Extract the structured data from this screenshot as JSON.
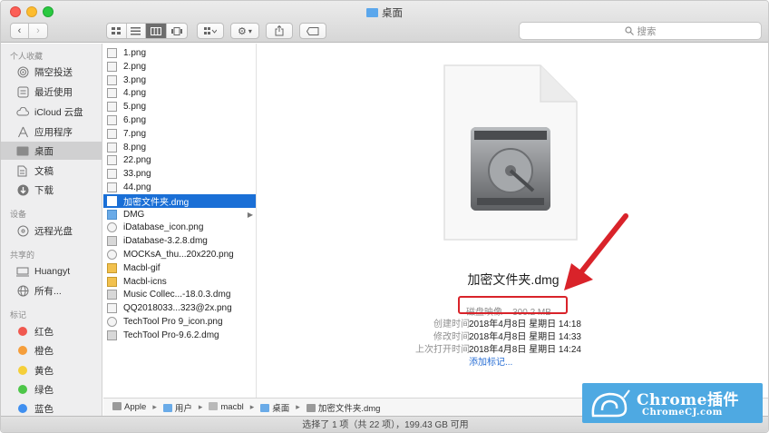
{
  "window": {
    "title": "桌面"
  },
  "toolbar": {
    "search_placeholder": "搜索",
    "search_icon": "magnifier-icon",
    "back_icon": "chevron-left-icon",
    "forward_icon": "chevron-right-icon"
  },
  "sidebar": {
    "sections": [
      {
        "title": "个人收藏"
      },
      {
        "title": "设备"
      },
      {
        "title": "共享的"
      },
      {
        "title": "标记"
      }
    ],
    "favorites": [
      {
        "label": "隔空投送",
        "icon": "airdrop-icon"
      },
      {
        "label": "最近使用",
        "icon": "recents-icon"
      },
      {
        "label": "iCloud 云盘",
        "icon": "cloud-icon"
      },
      {
        "label": "应用程序",
        "icon": "applications-icon"
      },
      {
        "label": "桌面",
        "icon": "desktop-icon",
        "selected": true
      },
      {
        "label": "文稿",
        "icon": "documents-icon"
      },
      {
        "label": "下载",
        "icon": "downloads-icon"
      }
    ],
    "devices": [
      {
        "label": "远程光盘",
        "icon": "disc-icon"
      }
    ],
    "shared": [
      {
        "label": "Huangyt",
        "icon": "computer-icon"
      },
      {
        "label": "所有...",
        "icon": "network-icon"
      }
    ],
    "tags": [
      {
        "label": "红色",
        "color": "#f0584f"
      },
      {
        "label": "橙色",
        "color": "#f59e3b"
      },
      {
        "label": "黄色",
        "color": "#f5cf3a"
      },
      {
        "label": "绿色",
        "color": "#4dc649"
      },
      {
        "label": "蓝色",
        "color": "#3f8ff0"
      }
    ]
  },
  "files": [
    {
      "name": "1.png",
      "kind": "image"
    },
    {
      "name": "2.png",
      "kind": "image"
    },
    {
      "name": "3.png",
      "kind": "image"
    },
    {
      "name": "4.png",
      "kind": "image"
    },
    {
      "name": "5.png",
      "kind": "image"
    },
    {
      "name": "6.png",
      "kind": "image"
    },
    {
      "name": "7.png",
      "kind": "image"
    },
    {
      "name": "8.png",
      "kind": "image"
    },
    {
      "name": "22.png",
      "kind": "image"
    },
    {
      "name": "33.png",
      "kind": "image"
    },
    {
      "name": "44.png",
      "kind": "image"
    },
    {
      "name": "加密文件夹.dmg",
      "kind": "dmg",
      "selected": true
    },
    {
      "name": "DMG",
      "kind": "folder"
    },
    {
      "name": "iDatabase_icon.png",
      "kind": "round"
    },
    {
      "name": "iDatabase-3.2.8.dmg",
      "kind": "dmg"
    },
    {
      "name": "MOCKsA_thu...20x220.png",
      "kind": "round"
    },
    {
      "name": "Macbl-gif",
      "kind": "gif"
    },
    {
      "name": "Macbl-icns",
      "kind": "gif"
    },
    {
      "name": "Music Collec...-18.0.3.dmg",
      "kind": "dmg"
    },
    {
      "name": "QQ2018033...323@2x.png",
      "kind": "image"
    },
    {
      "name": "TechTool Pro 9_icon.png",
      "kind": "round"
    },
    {
      "name": "TechTool Pro-9.6.2.dmg",
      "kind": "dmg"
    }
  ],
  "preview": {
    "file_name": "加密文件夹.dmg",
    "kind_size": "磁盘映像 – 300.2 MB",
    "meta": [
      {
        "label": "创建时间",
        "value": "2018年4月8日 星期日 14:18"
      },
      {
        "label": "修改时间",
        "value": "2018年4月8日 星期日 14:33"
      },
      {
        "label": "上次打开时间",
        "value": "2018年4月8日 星期日 14:24"
      }
    ],
    "add_tags": "添加标记..."
  },
  "pathbar": {
    "items": [
      {
        "label": "Apple",
        "icon": "hard-drive-icon"
      },
      {
        "label": "用户",
        "icon": "folder-icon"
      },
      {
        "label": "macbl",
        "icon": "home-icon"
      },
      {
        "label": "桌面",
        "icon": "folder-icon"
      },
      {
        "label": "加密文件夹.dmg",
        "icon": "dmg-icon"
      }
    ]
  },
  "statusbar": {
    "text": "选择了 1 项（共 22 项），199.43 GB 可用"
  },
  "watermark": {
    "main": "Chrome插件",
    "sub": "ChromeCJ.com"
  },
  "colors": {
    "selection": "#1a6fd6",
    "annotation": "#d9232a",
    "link": "#2a6fd5"
  }
}
